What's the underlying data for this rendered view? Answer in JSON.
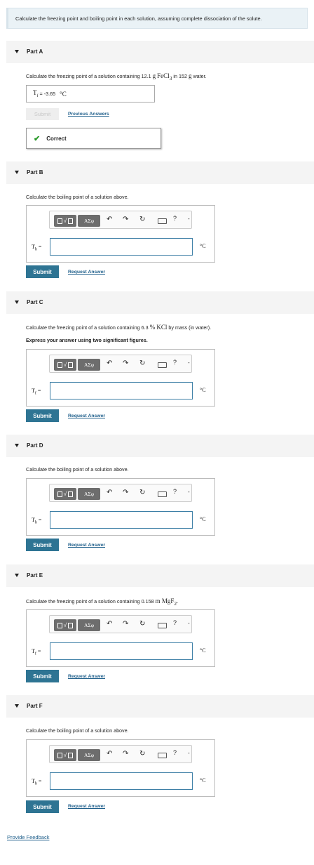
{
  "intro": "Calculate the freezing point and boiling point in each solution, assuming complete dissociation of the solute.",
  "partA": {
    "label": "Part A",
    "q_pre": "Calculate the freezing point of a solution containing 12.1 ",
    "q_unit1": "g",
    "q_formula": "FeCl3",
    "q_mid": " in 152 ",
    "q_unit2": "g",
    "q_post": " water.",
    "answer_var": "Tf",
    "answer_eq": " = ",
    "answer_value": "-3.65",
    "answer_unit": "°C",
    "submit_label": "Submit",
    "link_label": "Previous Answers",
    "correct_label": "Correct"
  },
  "partB": {
    "label": "Part B",
    "q": "Calculate the boiling point of a solution above.",
    "var": "Tb",
    "unit": "°C",
    "submit_label": "Submit",
    "link_label": "Request Answer"
  },
  "partC": {
    "label": "Part C",
    "q_pre": "Calculate the freezing point of a solution containing 6.3 ",
    "q_pct": "%",
    "q_formula": " KCl",
    "q_post": " by mass (in water).",
    "instruction": "Express your answer using two significant figures.",
    "var": "Tf",
    "unit": "°C",
    "submit_label": "Submit",
    "link_label": "Request Answer"
  },
  "partD": {
    "label": "Part D",
    "q": "Calculate the boiling point of a solution above.",
    "var": "Tb",
    "unit": "°C",
    "submit_label": "Submit",
    "link_label": "Request Answer"
  },
  "partE": {
    "label": "Part E",
    "q_pre": "Calculate the freezing point of a solution containing 0.158 ",
    "q_unit": "m",
    "q_formula": " MgF2",
    "q_post": ".",
    "var": "Tf",
    "unit": "°C",
    "submit_label": "Submit",
    "link_label": "Request Answer"
  },
  "partF": {
    "label": "Part F",
    "q": "Calculate the boiling point of a solution above.",
    "var": "Tb",
    "unit": "°C",
    "submit_label": "Submit",
    "link_label": "Request Answer"
  },
  "toolbar": {
    "greek_label": "ΑΣφ",
    "help": "?",
    "more": "-",
    "icons": [
      "templates-icon",
      "greek-symbols-icon",
      "undo-icon",
      "redo-icon",
      "reset-icon",
      "keyboard-icon",
      "help-icon"
    ]
  },
  "feedback_label": "Provide Feedback",
  "colors": {
    "submit_bg": "#2e7493",
    "link": "#1f5f8b",
    "correct_check": "#2a9a2a",
    "intro_bg": "#eaf2f6"
  }
}
